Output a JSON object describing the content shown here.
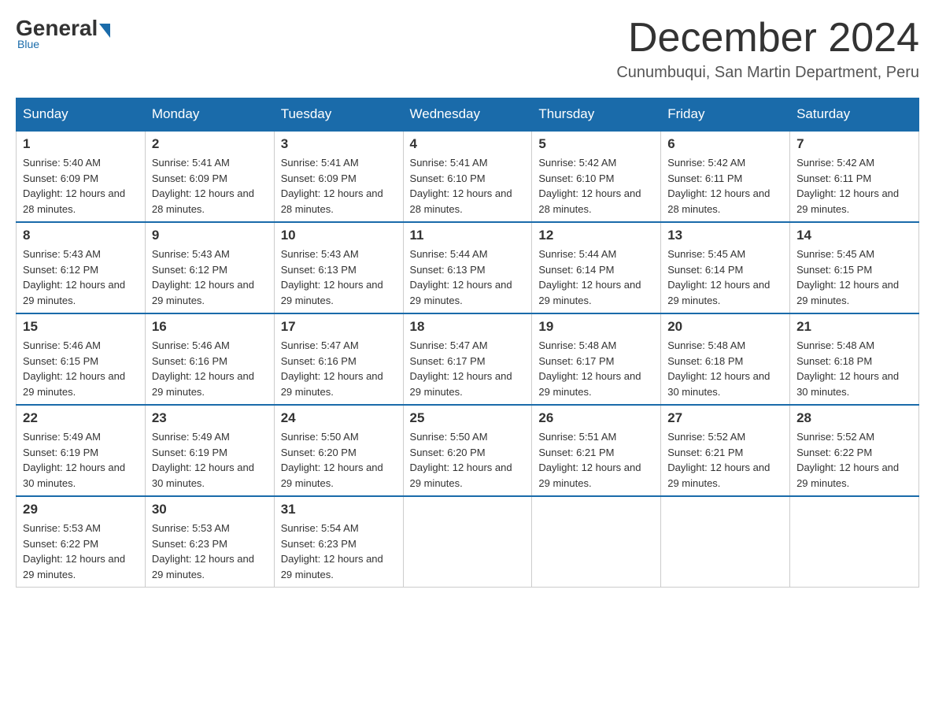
{
  "header": {
    "logo": {
      "general": "General",
      "blue": "Blue",
      "underline": "Blue"
    },
    "title": "December 2024",
    "location": "Cunumbuqui, San Martin Department, Peru"
  },
  "days_of_week": [
    "Sunday",
    "Monday",
    "Tuesday",
    "Wednesday",
    "Thursday",
    "Friday",
    "Saturday"
  ],
  "weeks": [
    [
      {
        "day": "1",
        "sunrise": "5:40 AM",
        "sunset": "6:09 PM",
        "daylight": "12 hours and 28 minutes."
      },
      {
        "day": "2",
        "sunrise": "5:41 AM",
        "sunset": "6:09 PM",
        "daylight": "12 hours and 28 minutes."
      },
      {
        "day": "3",
        "sunrise": "5:41 AM",
        "sunset": "6:09 PM",
        "daylight": "12 hours and 28 minutes."
      },
      {
        "day": "4",
        "sunrise": "5:41 AM",
        "sunset": "6:10 PM",
        "daylight": "12 hours and 28 minutes."
      },
      {
        "day": "5",
        "sunrise": "5:42 AM",
        "sunset": "6:10 PM",
        "daylight": "12 hours and 28 minutes."
      },
      {
        "day": "6",
        "sunrise": "5:42 AM",
        "sunset": "6:11 PM",
        "daylight": "12 hours and 28 minutes."
      },
      {
        "day": "7",
        "sunrise": "5:42 AM",
        "sunset": "6:11 PM",
        "daylight": "12 hours and 29 minutes."
      }
    ],
    [
      {
        "day": "8",
        "sunrise": "5:43 AM",
        "sunset": "6:12 PM",
        "daylight": "12 hours and 29 minutes."
      },
      {
        "day": "9",
        "sunrise": "5:43 AM",
        "sunset": "6:12 PM",
        "daylight": "12 hours and 29 minutes."
      },
      {
        "day": "10",
        "sunrise": "5:43 AM",
        "sunset": "6:13 PM",
        "daylight": "12 hours and 29 minutes."
      },
      {
        "day": "11",
        "sunrise": "5:44 AM",
        "sunset": "6:13 PM",
        "daylight": "12 hours and 29 minutes."
      },
      {
        "day": "12",
        "sunrise": "5:44 AM",
        "sunset": "6:14 PM",
        "daylight": "12 hours and 29 minutes."
      },
      {
        "day": "13",
        "sunrise": "5:45 AM",
        "sunset": "6:14 PM",
        "daylight": "12 hours and 29 minutes."
      },
      {
        "day": "14",
        "sunrise": "5:45 AM",
        "sunset": "6:15 PM",
        "daylight": "12 hours and 29 minutes."
      }
    ],
    [
      {
        "day": "15",
        "sunrise": "5:46 AM",
        "sunset": "6:15 PM",
        "daylight": "12 hours and 29 minutes."
      },
      {
        "day": "16",
        "sunrise": "5:46 AM",
        "sunset": "6:16 PM",
        "daylight": "12 hours and 29 minutes."
      },
      {
        "day": "17",
        "sunrise": "5:47 AM",
        "sunset": "6:16 PM",
        "daylight": "12 hours and 29 minutes."
      },
      {
        "day": "18",
        "sunrise": "5:47 AM",
        "sunset": "6:17 PM",
        "daylight": "12 hours and 29 minutes."
      },
      {
        "day": "19",
        "sunrise": "5:48 AM",
        "sunset": "6:17 PM",
        "daylight": "12 hours and 29 minutes."
      },
      {
        "day": "20",
        "sunrise": "5:48 AM",
        "sunset": "6:18 PM",
        "daylight": "12 hours and 30 minutes."
      },
      {
        "day": "21",
        "sunrise": "5:48 AM",
        "sunset": "6:18 PM",
        "daylight": "12 hours and 30 minutes."
      }
    ],
    [
      {
        "day": "22",
        "sunrise": "5:49 AM",
        "sunset": "6:19 PM",
        "daylight": "12 hours and 30 minutes."
      },
      {
        "day": "23",
        "sunrise": "5:49 AM",
        "sunset": "6:19 PM",
        "daylight": "12 hours and 30 minutes."
      },
      {
        "day": "24",
        "sunrise": "5:50 AM",
        "sunset": "6:20 PM",
        "daylight": "12 hours and 29 minutes."
      },
      {
        "day": "25",
        "sunrise": "5:50 AM",
        "sunset": "6:20 PM",
        "daylight": "12 hours and 29 minutes."
      },
      {
        "day": "26",
        "sunrise": "5:51 AM",
        "sunset": "6:21 PM",
        "daylight": "12 hours and 29 minutes."
      },
      {
        "day": "27",
        "sunrise": "5:52 AM",
        "sunset": "6:21 PM",
        "daylight": "12 hours and 29 minutes."
      },
      {
        "day": "28",
        "sunrise": "5:52 AM",
        "sunset": "6:22 PM",
        "daylight": "12 hours and 29 minutes."
      }
    ],
    [
      {
        "day": "29",
        "sunrise": "5:53 AM",
        "sunset": "6:22 PM",
        "daylight": "12 hours and 29 minutes."
      },
      {
        "day": "30",
        "sunrise": "5:53 AM",
        "sunset": "6:23 PM",
        "daylight": "12 hours and 29 minutes."
      },
      {
        "day": "31",
        "sunrise": "5:54 AM",
        "sunset": "6:23 PM",
        "daylight": "12 hours and 29 minutes."
      },
      null,
      null,
      null,
      null
    ]
  ]
}
